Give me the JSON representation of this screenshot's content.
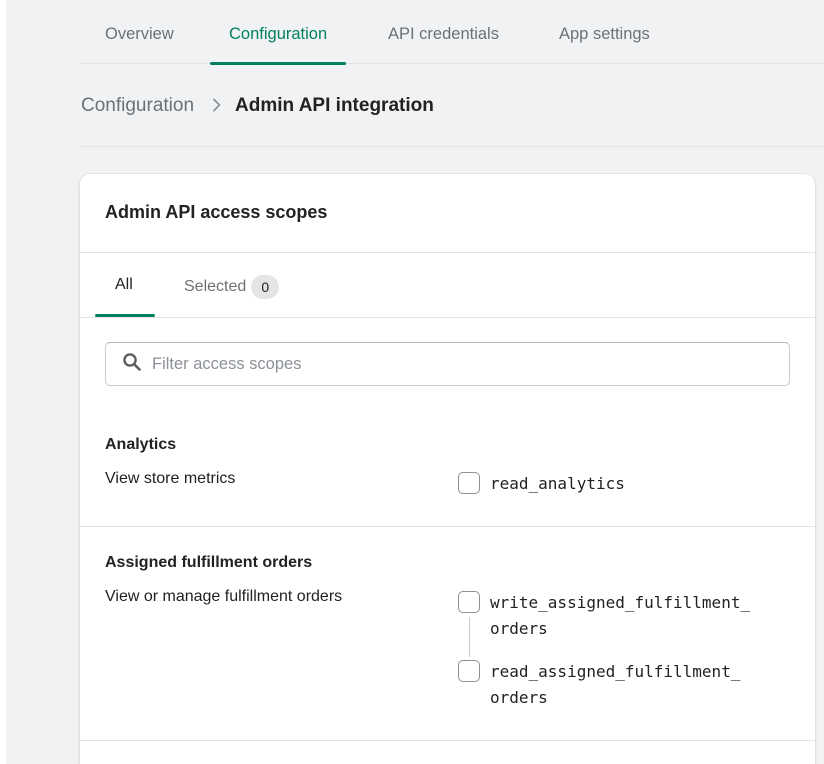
{
  "tabs": [
    {
      "label": "Overview",
      "active": false
    },
    {
      "label": "Configuration",
      "active": true
    },
    {
      "label": "API credentials",
      "active": false
    },
    {
      "label": "App settings",
      "active": false
    }
  ],
  "breadcrumb": {
    "parent": "Configuration",
    "current": "Admin API integration"
  },
  "card": {
    "title": "Admin API access scopes",
    "scope_tabs": {
      "all_label": "All",
      "selected_label": "Selected",
      "selected_count": "0"
    },
    "search": {
      "placeholder": "Filter access scopes",
      "value": ""
    },
    "sections": [
      {
        "title": "Analytics",
        "description": "View store metrics",
        "scopes": [
          {
            "label": "read_analytics",
            "checked": false
          }
        ]
      },
      {
        "title": "Assigned fulfillment orders",
        "description": "View or manage fulfillment orders",
        "scopes": [
          {
            "label": "write_assigned_fulfillment_\norders",
            "checked": false
          },
          {
            "label": "read_assigned_fulfillment_\norders",
            "checked": false
          }
        ]
      }
    ]
  },
  "colors": {
    "accent": "#008060",
    "background": "#f1f2f3",
    "text": "#202223",
    "subdued": "#6d7175"
  },
  "icons": {
    "search": "search-icon",
    "breadcrumb_separator": "chevron-right-icon"
  }
}
